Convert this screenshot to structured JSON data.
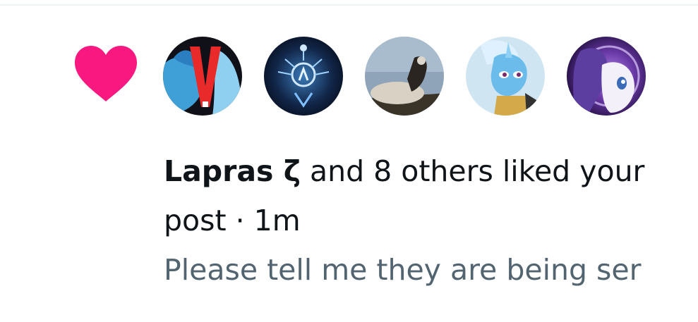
{
  "notification": {
    "actor_name": "Lapras ζ",
    "action_text": " and 8 others liked your",
    "object_text": "post",
    "separator": " · ",
    "timestamp": "1m",
    "post_preview": "Please tell me they are being ser"
  },
  "icons": {
    "notification_icon": "heart-icon",
    "heart_color": "#f91880"
  },
  "avatars": [
    {
      "name": "avatar-1"
    },
    {
      "name": "avatar-2"
    },
    {
      "name": "avatar-3"
    },
    {
      "name": "avatar-4"
    },
    {
      "name": "avatar-5"
    }
  ],
  "colors": {
    "primary_text": "#0f1419",
    "secondary_text": "#536471",
    "divider": "#eff3f4"
  }
}
